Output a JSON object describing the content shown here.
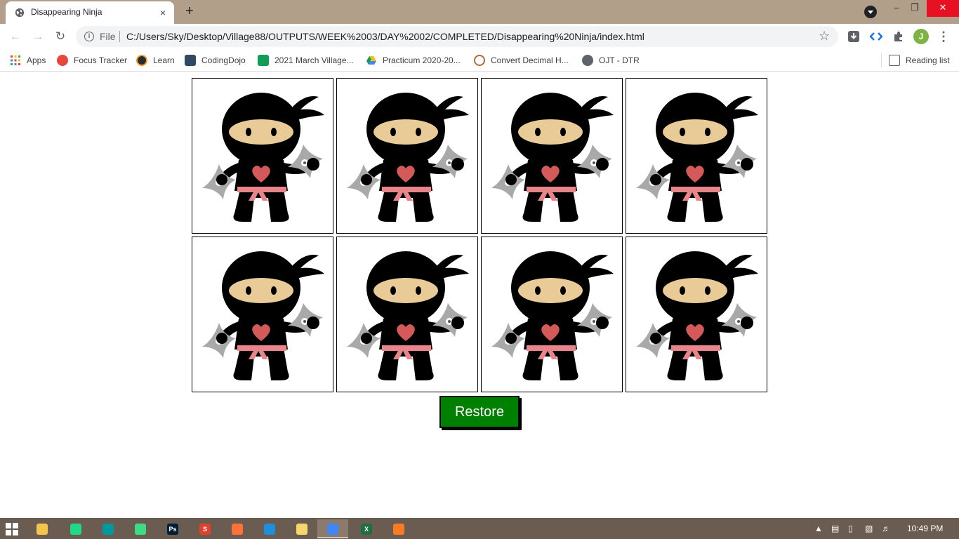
{
  "browser": {
    "tab": {
      "title": "Disappearing Ninja",
      "close": "×"
    },
    "new_tab": "+",
    "window_controls": {
      "minimize": "–",
      "restore": "❐",
      "close": "✕"
    },
    "address": {
      "scheme_label": "File",
      "url": "C:/Users/Sky/Desktop/Village88/OUTPUTS/WEEK%2003/DAY%2002/COMPLETED/Disappearing%20Ninja/index.html"
    },
    "profile_initial": "J",
    "bookmarks": [
      {
        "label": "Apps",
        "icon": "apps-grid-icon",
        "color": "#ea4335"
      },
      {
        "label": "Focus Tracker",
        "icon": "focus-tracker-icon",
        "color": "#e8453c"
      },
      {
        "label": "Learn",
        "icon": "learn-icon",
        "color": "#2b2b2b"
      },
      {
        "label": "CodingDojo",
        "icon": "codingdojo-icon",
        "color": "#2f4a64"
      },
      {
        "label": "2021 March Village...",
        "icon": "sheets-icon",
        "color": "#0f9d58"
      },
      {
        "label": "Practicum 2020-20...",
        "icon": "drive-icon",
        "color": "#fbbc04"
      },
      {
        "label": "Convert Decimal H...",
        "icon": "clock-icon",
        "color": "#b06a3b"
      },
      {
        "label": "OJT - DTR",
        "icon": "globe-icon",
        "color": "#5f6368"
      }
    ],
    "reading_list": "Reading list"
  },
  "page": {
    "ninja_alt": "ninja",
    "ninjas": [
      1,
      2,
      3,
      4,
      5,
      6,
      7,
      8
    ],
    "restore_label": "Restore",
    "colors": {
      "button_green": "#008000",
      "ninja_black": "#000000",
      "face_tan": "#e8cb96",
      "heart_red": "#d45a5a",
      "belt_pink": "#e8858a",
      "shuriken_grey": "#a9a9a9"
    }
  },
  "taskbar": {
    "apps": [
      {
        "name": "file-explorer",
        "label": "",
        "color": "#f3c54a"
      },
      {
        "name": "pycharm",
        "label": "",
        "color": "#21d789"
      },
      {
        "name": "arduino",
        "label": "",
        "color": "#00979d"
      },
      {
        "name": "android-studio",
        "label": "",
        "color": "#3ddc84"
      },
      {
        "name": "photoshop",
        "label": "Ps",
        "color": "#001e36"
      },
      {
        "name": "wps-office",
        "label": "S",
        "color": "#e0412b"
      },
      {
        "name": "firefox",
        "label": "",
        "color": "#ff7139"
      },
      {
        "name": "edge",
        "label": "",
        "color": "#1e8fd8"
      },
      {
        "name": "messenger",
        "label": "",
        "color": "#f5d76e"
      },
      {
        "name": "chrome",
        "label": "",
        "color": "#4285f4"
      },
      {
        "name": "excel",
        "label": "X",
        "color": "#1d6f42"
      },
      {
        "name": "xampp",
        "label": "",
        "color": "#fb7a24"
      }
    ],
    "clock": "10:49 PM"
  }
}
